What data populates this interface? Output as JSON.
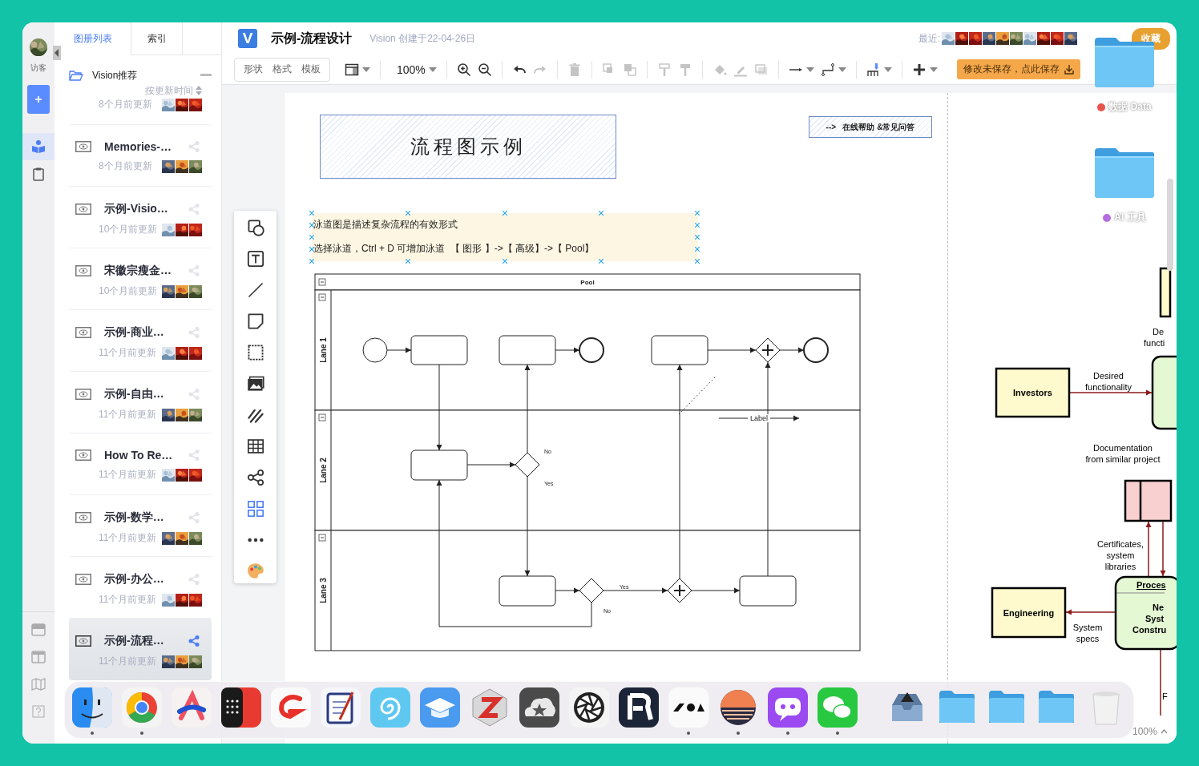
{
  "rail": {
    "user_label": "访客",
    "nav": [
      {
        "kind": "book",
        "selected": true
      },
      {
        "kind": "clipboard",
        "selected": false
      }
    ]
  },
  "sidebar": {
    "tabs": [
      {
        "label": "图册列表",
        "selected": true
      },
      {
        "label": "索引",
        "selected": false
      }
    ],
    "group": {
      "label": "Vision推荐",
      "expanded": true
    },
    "sort_label": "按更新时间",
    "items": [
      {
        "updated": "8个月前更新",
        "selected": false
      },
      {
        "title": "Memories-…",
        "updated": "8个月前更新",
        "selected": false
      },
      {
        "title": "示例-Visio…",
        "updated": "10个月前更新",
        "selected": false
      },
      {
        "title": "宋徽宗瘦金…",
        "updated": "10个月前更新",
        "selected": false
      },
      {
        "title": "示例-商业…",
        "updated": "11个月前更新",
        "selected": false
      },
      {
        "title": "示例-自由…",
        "updated": "11个月前更新",
        "selected": false
      },
      {
        "title": "How To Re…",
        "updated": "11个月前更新",
        "selected": false
      },
      {
        "title": "示例-数学…",
        "updated": "11个月前更新",
        "selected": false
      },
      {
        "title": "示例-办公…",
        "updated": "11个月前更新",
        "selected": false
      },
      {
        "title": "示例-流程…",
        "updated": "11个月前更新",
        "selected": true
      }
    ]
  },
  "header": {
    "logo": "V",
    "title": "示例-流程设计",
    "subtitle": "Vision 创建于22-04-26日",
    "recent_label": "最近:",
    "favorite_button": "收藏"
  },
  "toolbar": {
    "panel_tabs": [
      "形状",
      "格式",
      "模板"
    ],
    "tools": [
      {
        "kind": "layout",
        "disabled": false,
        "menu": true
      },
      {
        "kind": "sep"
      },
      {
        "kind": "zoom",
        "label": "100%",
        "menu": true
      },
      {
        "kind": "sep"
      },
      {
        "kind": "zoom_in",
        "disabled": false,
        "menu": false
      },
      {
        "kind": "zoom_out",
        "disabled": false,
        "menu": false
      },
      {
        "kind": "sep"
      },
      {
        "kind": "undo",
        "disabled": false,
        "menu": false
      },
      {
        "kind": "redo",
        "disabled": true,
        "menu": false
      },
      {
        "kind": "sep"
      },
      {
        "kind": "delete",
        "disabled": true,
        "menu": false
      },
      {
        "kind": "sep"
      },
      {
        "kind": "front",
        "disabled": true,
        "menu": false
      },
      {
        "kind": "back",
        "disabled": true,
        "menu": false
      },
      {
        "kind": "sep"
      },
      {
        "kind": "painter",
        "disabled": true,
        "menu": false
      },
      {
        "kind": "painter_all",
        "disabled": true,
        "menu": false
      },
      {
        "kind": "sep"
      },
      {
        "kind": "fill",
        "disabled": true,
        "menu": false
      },
      {
        "kind": "line_color",
        "disabled": true,
        "menu": false
      },
      {
        "kind": "shadow",
        "disabled": true,
        "menu": false
      },
      {
        "kind": "sep"
      },
      {
        "kind": "arrow",
        "disabled": false,
        "menu": true
      },
      {
        "kind": "connector",
        "disabled": false,
        "menu": true
      },
      {
        "kind": "sep"
      },
      {
        "kind": "insert",
        "disabled": false,
        "menu": true
      },
      {
        "kind": "sep"
      },
      {
        "kind": "plus",
        "disabled": false,
        "menu": true
      }
    ],
    "save_button": "修改未保存，点此保存"
  },
  "canvas": {
    "title_box": "流程图示例",
    "help_link": "-->   在线帮助 &常见问答",
    "note_lines": [
      "泳道图是描述复杂流程的有效形式",
      "选择泳道，Ctrl + D 可增加泳道  【 图形 】->【 高级】->【 Pool】"
    ],
    "pool": {
      "title": "Pool",
      "lanes": [
        "Lane 1",
        "Lane 2",
        "Lane 3"
      ],
      "edge_labels": [
        "No",
        "Yes",
        "Label",
        "Yes",
        "No"
      ]
    },
    "dfd": {
      "nodes": [
        {
          "kind": "entity",
          "label": "Investors"
        },
        {
          "kind": "entity",
          "label": "Engineering"
        },
        {
          "kind": "process",
          "title": "Proces",
          "lines": [
            "Ne",
            "Syst",
            "Constru"
          ]
        }
      ],
      "flow_labels": [
        [
          "De",
          "functi"
        ],
        [
          "Desired",
          "functionality"
        ],
        [
          "Documentation",
          "from similar project"
        ],
        [
          "Certificates,",
          "system",
          "libraries"
        ],
        [
          "System",
          "specs"
        ],
        [
          "F"
        ]
      ]
    },
    "zoom_label": "100%"
  },
  "desktop_folders": [
    {
      "label": "数据 Data",
      "color": "#e8534a"
    },
    {
      "label": "AI 工具",
      "color": "#b46ee0"
    }
  ],
  "dock": {
    "apps": [
      {
        "running": true
      },
      {
        "running": true
      },
      {
        "running": false
      },
      {
        "running": false
      },
      {
        "running": false
      },
      {
        "running": false
      },
      {
        "running": false
      },
      {
        "running": false
      },
      {
        "running": false
      },
      {
        "running": false
      },
      {
        "running": false
      },
      {
        "running": false
      },
      {
        "running": true
      },
      {
        "running": true
      },
      {
        "running": true
      },
      {
        "running": true
      }
    ]
  }
}
